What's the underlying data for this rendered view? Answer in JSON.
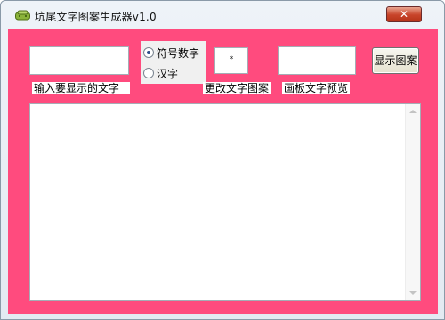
{
  "window": {
    "title": "坑尾文字图案生成器v1.0",
    "close_glyph": "✕",
    "icon": "app-icon"
  },
  "inputs": {
    "display_text_value": "",
    "preview_text_value": "",
    "pattern_char": "*"
  },
  "labels": {
    "display_text": "输入要显示的文字",
    "change_pattern": "更改文字图案",
    "preview_text": "画板文字预览"
  },
  "mode": {
    "options": [
      "符号数字",
      "汉字"
    ],
    "selected": "符号数字"
  },
  "buttons": {
    "show_pattern": "显示图案"
  },
  "output": {
    "text": ""
  },
  "colors": {
    "client_background": "#ff4b7e"
  }
}
